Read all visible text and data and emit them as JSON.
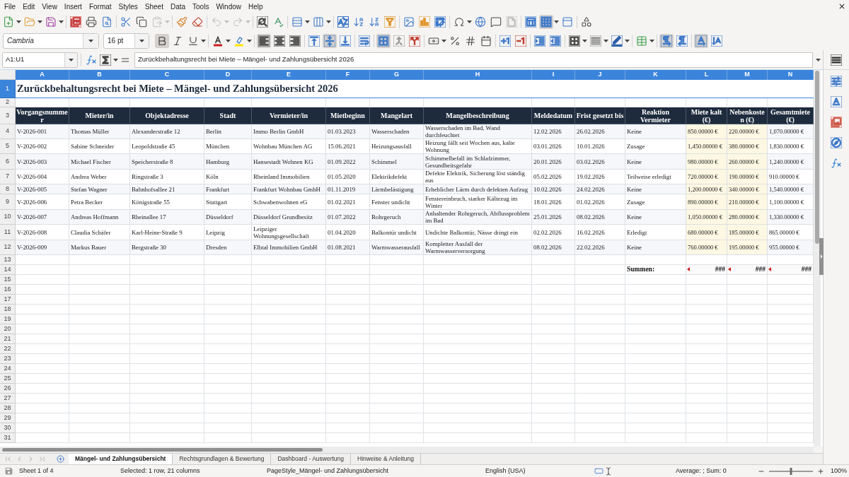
{
  "menu_bar": {
    "items": [
      "File",
      "Edit",
      "View",
      "Insert",
      "Format",
      "Styles",
      "Sheet",
      "Data",
      "Tools",
      "Window",
      "Help"
    ]
  },
  "standard_toolbar": {
    "paste_disabled": true,
    "undo_disabled": true,
    "redo_disabled": true,
    "headers_footers_disabled": true,
    "freeze_rows_columns_on": true
  },
  "formatting_toolbar": {
    "font_name": "Cambria",
    "font_size": "16 pt",
    "bold": true,
    "italic": false,
    "underline": false,
    "align_left": true,
    "align_center": false,
    "align_right": false,
    "align_top": false,
    "center_vertically": true,
    "align_bottom": false,
    "wrap_text": false,
    "merge_and_center": true,
    "left_to_right": true,
    "right_to_left": false,
    "text_left_to_right": true,
    "text_top_to_bottom": false
  },
  "formula_bar": {
    "name_box": "A1:U1",
    "formula": "Zurückbehaltungsrecht bei Miete – Mängel- und Zahlungsübersicht 2026"
  },
  "sheet": {
    "columns": [
      {
        "label": "A",
        "selected": true
      },
      {
        "label": "B",
        "selected": true
      },
      {
        "label": "C",
        "selected": true
      },
      {
        "label": "D",
        "selected": true
      },
      {
        "label": "E",
        "selected": true
      },
      {
        "label": "F",
        "selected": true
      },
      {
        "label": "G",
        "selected": true
      },
      {
        "label": "H",
        "selected": true
      },
      {
        "label": "I",
        "selected": true
      },
      {
        "label": "J",
        "selected": true
      },
      {
        "label": "K",
        "selected": true
      },
      {
        "label": "L",
        "selected": true
      },
      {
        "label": "M",
        "selected": true
      },
      {
        "label": "N",
        "selected": true
      }
    ],
    "rows": [
      {
        "label": "1",
        "selected": true,
        "kind": "title",
        "text": "Zurückbehaltungsrecht bei Miete – Mängel- und Zahlungsübersicht 2026"
      },
      {
        "label": "2",
        "selected": false,
        "kind": "empty"
      },
      {
        "label": "3",
        "selected": false,
        "kind": "header",
        "cells": [
          "Vorgangsnummer",
          "Mieter/in",
          "Objektadresse",
          "Stadt",
          "Vermieter/in",
          "Mietbeginn",
          "Mangelart",
          "Mangelbeschreibung",
          "Meldedatum",
          "Frist gesetzt bis",
          "Reaktion Vermieter",
          "Miete kalt (€)",
          "Nebenkosten (€)",
          "Gesamtmiete (€)"
        ]
      },
      {
        "label": "4",
        "selected": false,
        "kind": "data",
        "cells": [
          "V-2026-001",
          "Thomas Müller",
          "Alexanderstraße 12",
          "Berlin",
          "Immo Berlin GmbH",
          "01.03.2023",
          "Wasserschaden",
          "Wasserschaden im Bad, Wand durchfeuchtet",
          "12.02.2026",
          "26.02.2026",
          "Keine",
          "850.00000 €",
          "220.00000 €",
          "1,070.00000 €"
        ]
      },
      {
        "label": "5",
        "selected": false,
        "kind": "data",
        "cells": [
          "V-2026-002",
          "Sabine Schneider",
          "Leopoldstraße 45",
          "München",
          "Wohnbau München AG",
          "15.06.2021",
          "Heizungsausfall",
          "Heizung fällt seit Wochen aus, kalte Wohnung",
          "03.01.2026",
          "10.01.2026",
          "Zusage",
          "1,450.00000 €",
          "380.00000 €",
          "1,830.00000 €"
        ]
      },
      {
        "label": "6",
        "selected": false,
        "kind": "data",
        "cells": [
          "V-2026-003",
          "Michael Fischer",
          "Speicherstraße 8",
          "Hamburg",
          "Hansestadt Wohnen KG",
          "01.09.2022",
          "Schimmel",
          "Schimmelbefall im Schlafzimmer, Gesundheitsgefahr",
          "20.01.2026",
          "03.02.2026",
          "Keine",
          "980.00000 €",
          "260.00000 €",
          "1,240.00000 €"
        ]
      },
      {
        "label": "7",
        "selected": false,
        "kind": "data",
        "cells": [
          "V-2026-004",
          "Andrea Weber",
          "Ringstraße 3",
          "Köln",
          "Rheinland Immobilien",
          "01.05.2020",
          "Elektrikdefekt",
          "Defekte Elektrik, Sicherung löst ständig aus",
          "05.02.2026",
          "19.02.2026",
          "Teilweise erledigt",
          "720.00000 €",
          "190.00000 €",
          "910.00000 €"
        ]
      },
      {
        "label": "8",
        "selected": false,
        "kind": "data",
        "cells": [
          "V-2026-005",
          "Stefan Wagner",
          "Bahnhofsallee 21",
          "Frankfurt",
          "Frankfurt Wohnbau GmbH",
          "01.11.2019",
          "Lärmbelästigung",
          "Erheblicher Lärm durch defekten Aufzug",
          "10.02.2026",
          "24.02.2026",
          "Keine",
          "1,200.00000 €",
          "340.00000 €",
          "1,540.00000 €"
        ]
      },
      {
        "label": "9",
        "selected": false,
        "kind": "data",
        "cells": [
          "V-2026-006",
          "Petra Becker",
          "Königstraße 55",
          "Stuttgart",
          "Schwabenwohnen eG",
          "01.02.2021",
          "Fenster undicht",
          "Fenstereinbruch, starker Kältezug im Winter",
          "18.01.2026",
          "01.02.2026",
          "Zusage",
          "890.00000 €",
          "210.00000 €",
          "1,100.00000 €"
        ]
      },
      {
        "label": "10",
        "selected": false,
        "kind": "data",
        "cells": [
          "V-2026-007",
          "Andreas Hoffmann",
          "Rheinallee 17",
          "Düsseldorf",
          "Düsseldorf Grundbesitz",
          "01.07.2022",
          "Rohrgeruch",
          "Anhaltender Rohrgeruch, Abflussproblem im Bad",
          "25.01.2026",
          "08.02.2026",
          "Keine",
          "1,050.00000 €",
          "280.00000 €",
          "1,330.00000 €"
        ]
      },
      {
        "label": "11",
        "selected": false,
        "kind": "data",
        "cells": [
          "V-2026-008",
          "Claudia Schäfer",
          "Karl-Heine-Straße 9",
          "Leipzig",
          "Leipziger Wohnungsgesellschaft",
          "01.04.2020",
          "Balkontür undicht",
          "Undichte Balkontür, Nässe dringt ein",
          "02.02.2026",
          "16.02.2026",
          "Erledigt",
          "680.00000 €",
          "185.00000 €",
          "865.00000 €"
        ]
      },
      {
        "label": "12",
        "selected": false,
        "kind": "data",
        "cells": [
          "V-2026-009",
          "Markus Bauer",
          "Bergstraße 30",
          "Dresden",
          "Elbtal Immobilien GmbH",
          "01.08.2021",
          "Warmwasserausfall",
          "Kompletter Ausfall der Warmwasserversorgung",
          "08.02.2026",
          "22.02.2026",
          "Keine",
          "760.00000 €",
          "195.00000 €",
          "955.00000 €"
        ]
      },
      {
        "label": "13",
        "selected": false,
        "kind": "empty"
      },
      {
        "label": "14",
        "selected": false,
        "kind": "totals",
        "caption": "Summen:",
        "values": [
          "###",
          "###",
          "###"
        ]
      },
      {
        "label": "15",
        "selected": false,
        "kind": "empty"
      },
      {
        "label": "16",
        "selected": false,
        "kind": "empty"
      },
      {
        "label": "17",
        "selected": false,
        "kind": "empty"
      },
      {
        "label": "18",
        "selected": false,
        "kind": "empty"
      },
      {
        "label": "19",
        "selected": false,
        "kind": "empty"
      },
      {
        "label": "20",
        "selected": false,
        "kind": "empty"
      },
      {
        "label": "21",
        "selected": false,
        "kind": "empty"
      },
      {
        "label": "22",
        "selected": false,
        "kind": "empty"
      },
      {
        "label": "23",
        "selected": false,
        "kind": "empty"
      },
      {
        "label": "24",
        "selected": false,
        "kind": "empty"
      },
      {
        "label": "25",
        "selected": false,
        "kind": "empty"
      },
      {
        "label": "26",
        "selected": false,
        "kind": "empty"
      },
      {
        "label": "27",
        "selected": false,
        "kind": "empty"
      },
      {
        "label": "28",
        "selected": false,
        "kind": "empty"
      },
      {
        "label": "29",
        "selected": false,
        "kind": "empty"
      },
      {
        "label": "30",
        "selected": false,
        "kind": "empty"
      },
      {
        "label": "31",
        "selected": false,
        "kind": "empty"
      }
    ]
  },
  "sheet_tabs": [
    {
      "label": "Mängel- und Zahlungsübersicht",
      "selected": true
    },
    {
      "label": "Rechtsgrundlagen & Bewertung",
      "selected": false
    },
    {
      "label": "Dashboard - Auswertung",
      "selected": false
    },
    {
      "label": "Hinweise & Anleitung",
      "selected": false
    }
  ],
  "status_bar": {
    "sheet": "Sheet 1 of 4",
    "selection": "Selected: 1 row, 21 columns",
    "page_style": "PageStyle_Mängel- und Zahlungsübersicht",
    "language": "English (USA)",
    "summary": "Average: ; Sum: 0",
    "zoom": {
      "level": 0.5,
      "reading": "100%"
    }
  }
}
